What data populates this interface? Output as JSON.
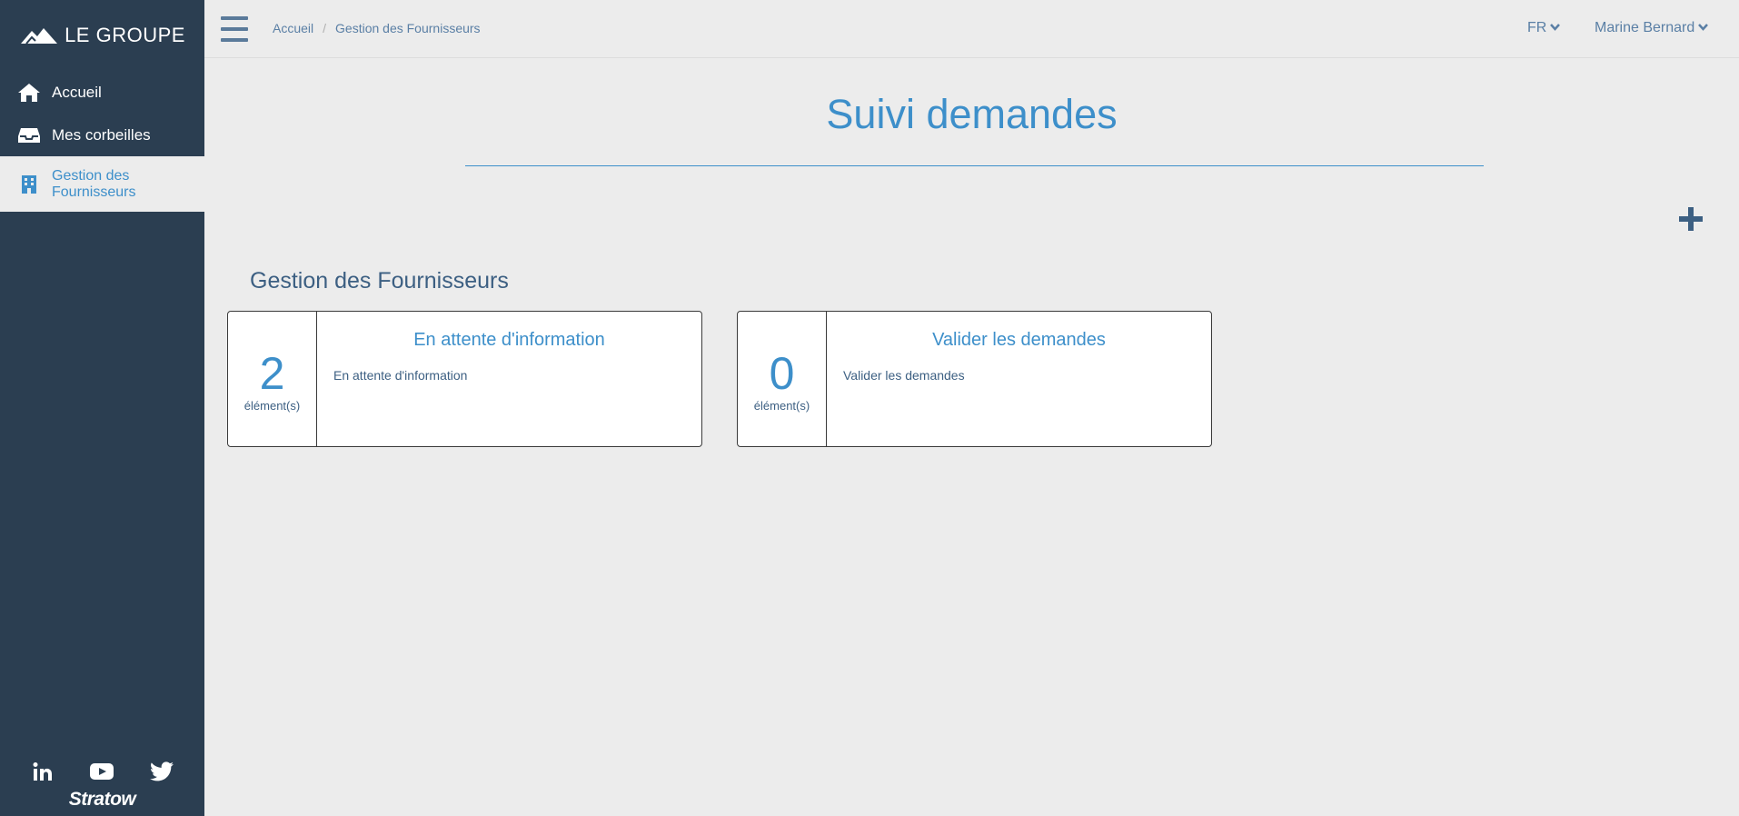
{
  "brand": {
    "name": "LE GROUPE"
  },
  "sidebar": {
    "items": [
      {
        "label": "Accueil",
        "icon": "home-icon"
      },
      {
        "label": "Mes corbeilles",
        "icon": "inbox-icon"
      },
      {
        "label": "Gestion des Fournisseurs",
        "icon": "building-icon",
        "active": true
      }
    ],
    "social": [
      "linkedin-icon",
      "youtube-icon",
      "twitter-icon"
    ],
    "footer_logo": "Stratow"
  },
  "breadcrumb": [
    "Accueil",
    "Gestion des Fournisseurs"
  ],
  "header": {
    "lang": "FR",
    "user": "Marine Bernard"
  },
  "page": {
    "title": "Suivi demandes"
  },
  "section": {
    "title": "Gestion des Fournisseurs",
    "cards": [
      {
        "count": "2",
        "count_label": "élément(s)",
        "title": "En attente d'information",
        "desc": "En attente d'information"
      },
      {
        "count": "0",
        "count_label": "élément(s)",
        "title": "Valider les demandes",
        "desc": "Valider les demandes"
      }
    ]
  },
  "colors": {
    "sidebar": "#2b3e51",
    "accent": "#3d8fca",
    "background": "#ececec"
  }
}
